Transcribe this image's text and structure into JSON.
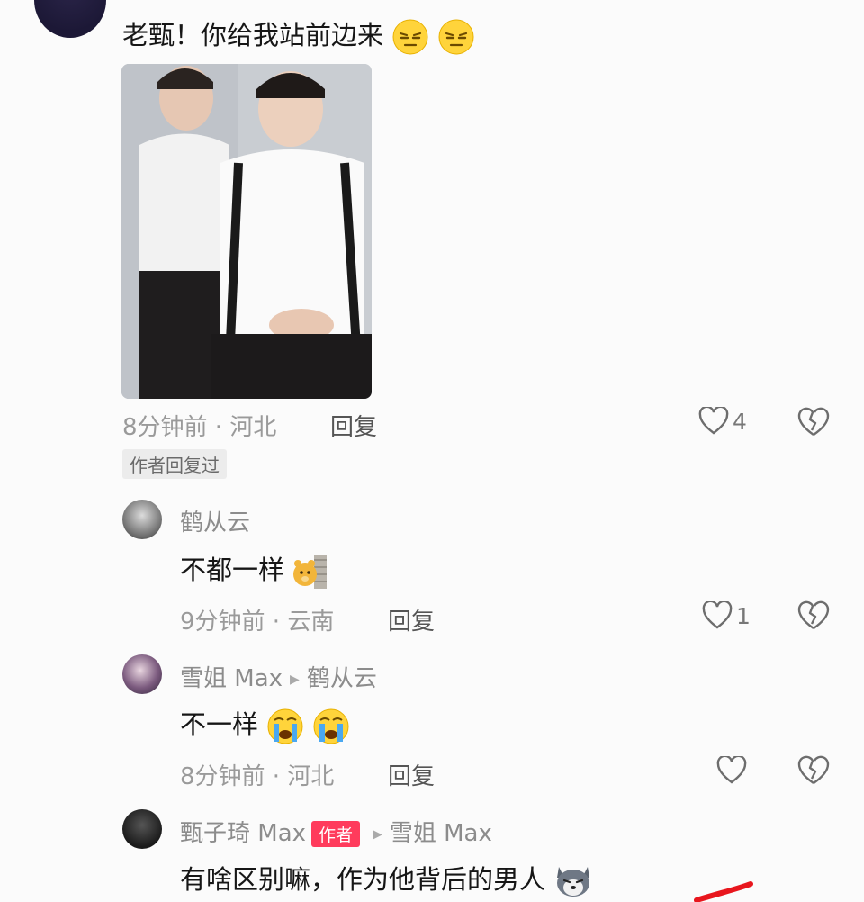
{
  "comment": {
    "text": "老甄！你给我站前边来",
    "meta": "8分钟前 · 河北",
    "reply_label": "回复",
    "like_count": "4",
    "author_replied_badge": "作者回复过",
    "emojis": [
      "annoyed-face",
      "annoyed-face"
    ]
  },
  "replies": [
    {
      "user": "鹤从云",
      "text": "不都一样",
      "meta": "9分钟前 · 云南",
      "reply_label": "回复",
      "like_count": "1",
      "emoji": "bear-peeking-from-wall"
    },
    {
      "user": "雪姐 Max",
      "reply_to": "鹤从云",
      "text": "不一样",
      "meta": "8分钟前 · 河北",
      "reply_label": "回复",
      "like_count": "",
      "emojis": [
        "crying-face",
        "crying-face"
      ]
    },
    {
      "user": "甄子琦 Max",
      "author_badge": "作者",
      "reply_to": "雪姐 Max",
      "text": "有啥区别嘛，作为他背后的男人",
      "emoji": "husky-dog"
    }
  ],
  "colors": {
    "background": "#fbfbfb",
    "author_badge": "#ff3b5c",
    "text_primary": "#161616",
    "text_meta": "#9a9a9a"
  }
}
